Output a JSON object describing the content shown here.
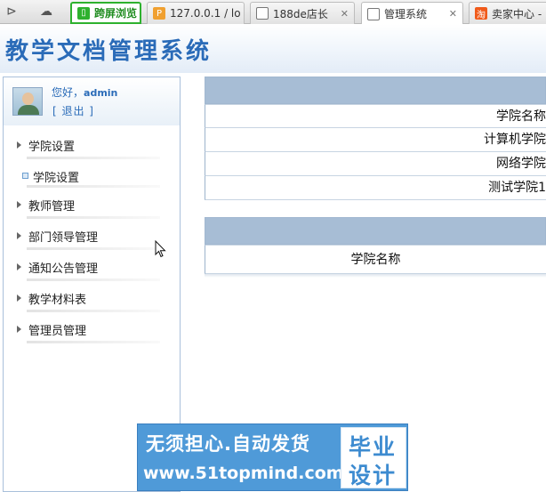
{
  "browser": {
    "tabs": [
      {
        "label": "跨屏浏览",
        "icon": "phone-icon"
      },
      {
        "label": "127.0.0.1 / lo",
        "icon": "phpmyadmin-icon",
        "close": "✕"
      },
      {
        "label": "188de店长 ",
        "icon": "page-icon",
        "close": "✕"
      },
      {
        "label": "管理系统",
        "icon": "page-icon",
        "close": "✕",
        "active": true
      },
      {
        "label": "卖家中心 -",
        "icon": "taobao-icon"
      }
    ]
  },
  "header": {
    "title": "教学文档管理系统"
  },
  "sidebar": {
    "greeting": "您好，",
    "username": "admin",
    "logout": "[ 退出 ]",
    "menu": [
      {
        "label": "学院设置"
      },
      {
        "label": "学院设置",
        "sub": true
      },
      {
        "label": "教师管理"
      },
      {
        "label": "部门领导管理"
      },
      {
        "label": "通知公告管理"
      },
      {
        "label": "教学材料表"
      },
      {
        "label": "管理员管理"
      }
    ]
  },
  "table1": {
    "header": "学院名称",
    "rows": [
      "计算机学院",
      "网络学院",
      "测试学院1"
    ]
  },
  "table2": {
    "header": "学院名称"
  },
  "watermark": {
    "line1": "无须担心.自动发货",
    "line2": "www.51topmind.com",
    "badge1": "毕业",
    "badge2": "设计"
  },
  "colors": {
    "accent": "#2a6bb8",
    "table_header": "#a7bdd5",
    "watermark_bg": "#4f9ad8"
  }
}
